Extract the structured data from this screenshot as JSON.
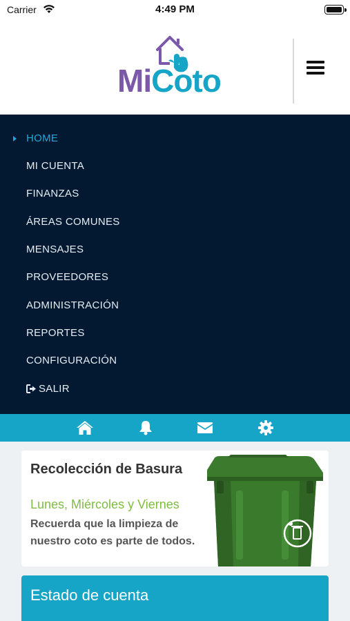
{
  "status_bar": {
    "carrier": "Carrier",
    "time": "4:49 PM",
    "icons": [
      "wifi-icon",
      "battery-icon"
    ]
  },
  "header": {
    "logo": {
      "part1": "Mi",
      "part2": "Coto",
      "colors": {
        "mi": "#7b58a8",
        "coto": "#16a5c7"
      }
    },
    "menu_icon": "hamburger-icon"
  },
  "nav": {
    "background": "#031932",
    "active_color": "#22a8d6",
    "items": [
      {
        "label": "HOME",
        "active": true
      },
      {
        "label": "MI CUENTA"
      },
      {
        "label": "FINANZAS"
      },
      {
        "label": "ÁREAS COMUNES"
      },
      {
        "label": "MENSAJES"
      },
      {
        "label": "PROVEEDORES"
      },
      {
        "label": "ADMINISTRACIÓN"
      },
      {
        "label": "REPORTES"
      },
      {
        "label": "CONFIGURACIÓN"
      },
      {
        "label": "SALIR",
        "icon": "sign-out-icon"
      }
    ]
  },
  "toolbar": {
    "background": "#16a5c7",
    "icons": [
      "home-icon",
      "bell-icon",
      "envelope-icon",
      "gear-icon"
    ]
  },
  "announcement": {
    "title": "Recolección de Basura",
    "days": "Lunes, Miércoles y Viernes",
    "message": "Recuerda que la limpieza de nuestro coto es parte de todos.",
    "image": "trash-bin-image"
  },
  "account": {
    "title": "Estado de cuenta"
  }
}
